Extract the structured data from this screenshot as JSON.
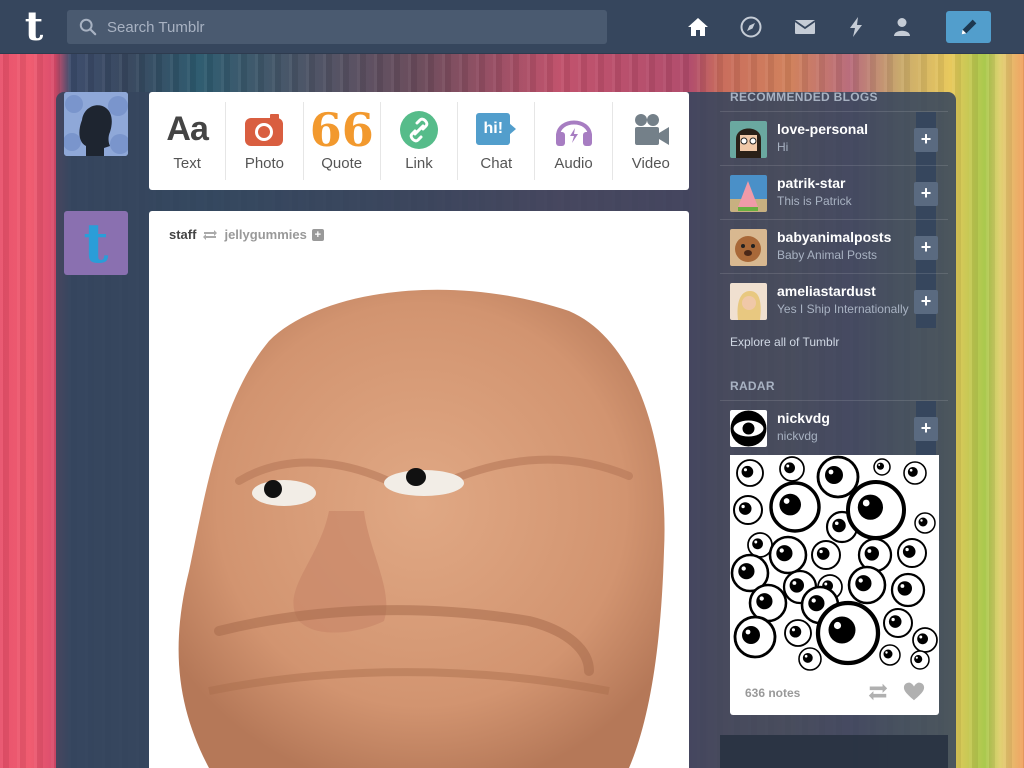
{
  "header": {
    "logo_letter": "t",
    "search_placeholder": "Search Tumblr",
    "nav_icons": [
      "home-icon",
      "explore-icon",
      "inbox-icon",
      "activity-icon",
      "account-icon"
    ],
    "compose_icon": "pencil-icon"
  },
  "post_types": [
    {
      "label": "Text",
      "icon": "text-icon",
      "glyph": "Aa",
      "color": "#444444"
    },
    {
      "label": "Photo",
      "icon": "camera-icon",
      "color": "#d95e40"
    },
    {
      "label": "Quote",
      "icon": "quote-icon",
      "glyph": "66",
      "color": "#f2992e"
    },
    {
      "label": "Link",
      "icon": "link-icon",
      "color": "#56bc8a"
    },
    {
      "label": "Chat",
      "icon": "chat-icon",
      "glyph": "hi!",
      "color": "#529ecc"
    },
    {
      "label": "Audio",
      "icon": "headphones-icon",
      "color": "#a77dc2"
    },
    {
      "label": "Video",
      "icon": "video-camera-icon",
      "color": "#748089"
    }
  ],
  "post": {
    "author": "staff",
    "reblogged_from": "jellygummies",
    "follow_symbol": "+"
  },
  "sidebar": {
    "recommended_title": "RECOMMENDED BLOGS",
    "blogs": [
      {
        "name": "love-personal",
        "desc": "Hi"
      },
      {
        "name": "patrik-star",
        "desc": "This is Patrick"
      },
      {
        "name": "babyanimalposts",
        "desc": "Baby Animal Posts"
      },
      {
        "name": "ameliastardust",
        "desc": "Yes I Ship Internationally"
      }
    ],
    "follow_symbol": "+",
    "explore_link": "Explore all of Tumblr",
    "radar_title": "RADAR",
    "radar": {
      "name": "nickvdg",
      "desc": "nickvdg",
      "notes": "636 notes"
    }
  },
  "colors": {
    "navy": "#36465d",
    "accent_blue": "#529ecc"
  }
}
